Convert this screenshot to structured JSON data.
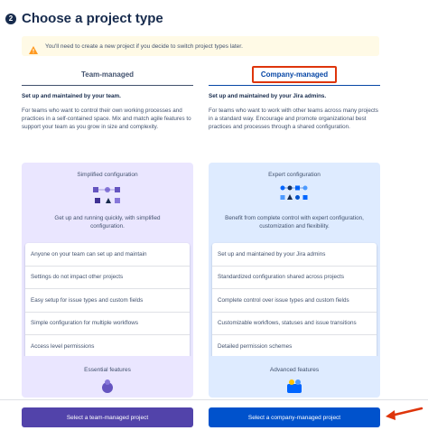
{
  "header": {
    "step": "2",
    "title": "Choose a project type"
  },
  "warning": {
    "text": "You'll need to create a new project if you decide to switch project types later."
  },
  "team": {
    "tab": "Team-managed",
    "tagline": "Set up and maintained by your team.",
    "description": "For teams who want to control their own working processes and practices in a self-contained space. Mix and match agile features to support your team as you grow in size and complexity.",
    "card_title": "Simplified configuration",
    "card_text": "Get up and running quickly, with simplified configuration.",
    "features": [
      "Anyone on your team can set up and maintain",
      "Settings do not impact other projects",
      "Easy setup for issue types and custom fields",
      "Simple configuration for multiple workflows",
      "Access level permissions"
    ],
    "card2_title": "Essential features",
    "button": "Select a team-managed project"
  },
  "company": {
    "tab": "Company-managed",
    "tagline": "Set up and maintained by your Jira admins.",
    "description": "For teams who want to work with other teams across many projects in a standard way. Encourage and promote organizational best practices and processes through a shared configuration.",
    "card_title": "Expert configuration",
    "card_text": "Benefit from complete control with expert configuration, customization and flexibility.",
    "features": [
      "Set up and maintained by your Jira admins",
      "Standardized configuration shared across projects",
      "Complete control over issue types and custom fields",
      "Customizable workflows, statuses and issue transitions",
      "Detailed permission schemes"
    ],
    "card2_title": "Advanced features",
    "button": "Select a company-managed project"
  },
  "colors": {
    "team_accent": "#5243aa",
    "company_accent": "#0052cc",
    "highlight": "#de350b",
    "arrow": "#de350b"
  }
}
